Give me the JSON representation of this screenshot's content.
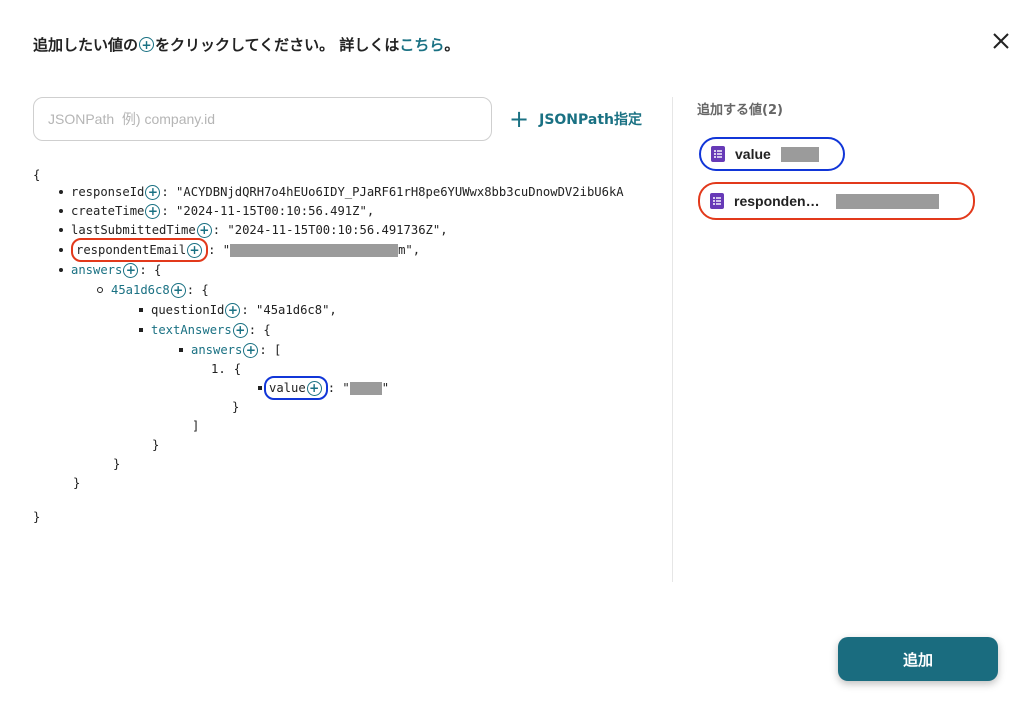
{
  "header": {
    "prefix": "追加したい値の",
    "plus_symbol": "+",
    "middle": "をクリックしてください。 詳しくは",
    "link": "こちら",
    "suffix": "。"
  },
  "search": {
    "placeholder": "JSONPath  例) company.id",
    "value": ""
  },
  "jsonpath_button": {
    "plus": "+",
    "label": "JSONPath指定"
  },
  "tree": {
    "open_brace": "{",
    "response_id": {
      "key": "responseId",
      "value": ": \"ACYDBNjdQRH7o4hEUo6IDY_PJaRF61rH8pe6YUWwx8bb3cuDnowDV2ibU6kA"
    },
    "create_time": {
      "key": "createTime",
      "value": ": \"2024-11-15T00:10:56.491Z\","
    },
    "last_submitted_time": {
      "key": "lastSubmittedTime",
      "value": ": \"2024-11-15T00:10:56.491736Z\","
    },
    "respondent_email": {
      "key": "respondentEmail",
      "prefix": ": \"",
      "suffix": "m\","
    },
    "answers": {
      "key": "answers",
      "suffix": ": {"
    },
    "answer_id": {
      "key": "45a1d6c8",
      "suffix": ": {"
    },
    "question_id": {
      "key": "questionId",
      "value": ": \"45a1d6c8\","
    },
    "text_answers": {
      "key": "textAnswers",
      "suffix": ": {"
    },
    "inner_answers": {
      "key": "answers",
      "suffix": ": ["
    },
    "item_number": "1.",
    "item_open": "{",
    "value_item": {
      "key": "value",
      "prefix": ": \"",
      "suffix": "\""
    },
    "close_inner_obj": "}",
    "close_bracket": "]",
    "close_text_answers": "}",
    "close_answer_id": "}",
    "close_answers": "}",
    "close_root": "}"
  },
  "right_panel": {
    "title": "追加する値(2)",
    "chips": [
      {
        "label": "value"
      },
      {
        "label": "responden…"
      }
    ]
  },
  "add_button": {
    "label": "追加"
  },
  "colors": {
    "accent": "#1a7183",
    "button": "#1a6c7f",
    "highlight_red": "#e2391b",
    "highlight_blue": "#1136d8",
    "forms_purple": "#673ab7"
  },
  "icons": [
    "plus-circle-icon",
    "close-icon",
    "plus-icon",
    "google-forms-icon"
  ]
}
